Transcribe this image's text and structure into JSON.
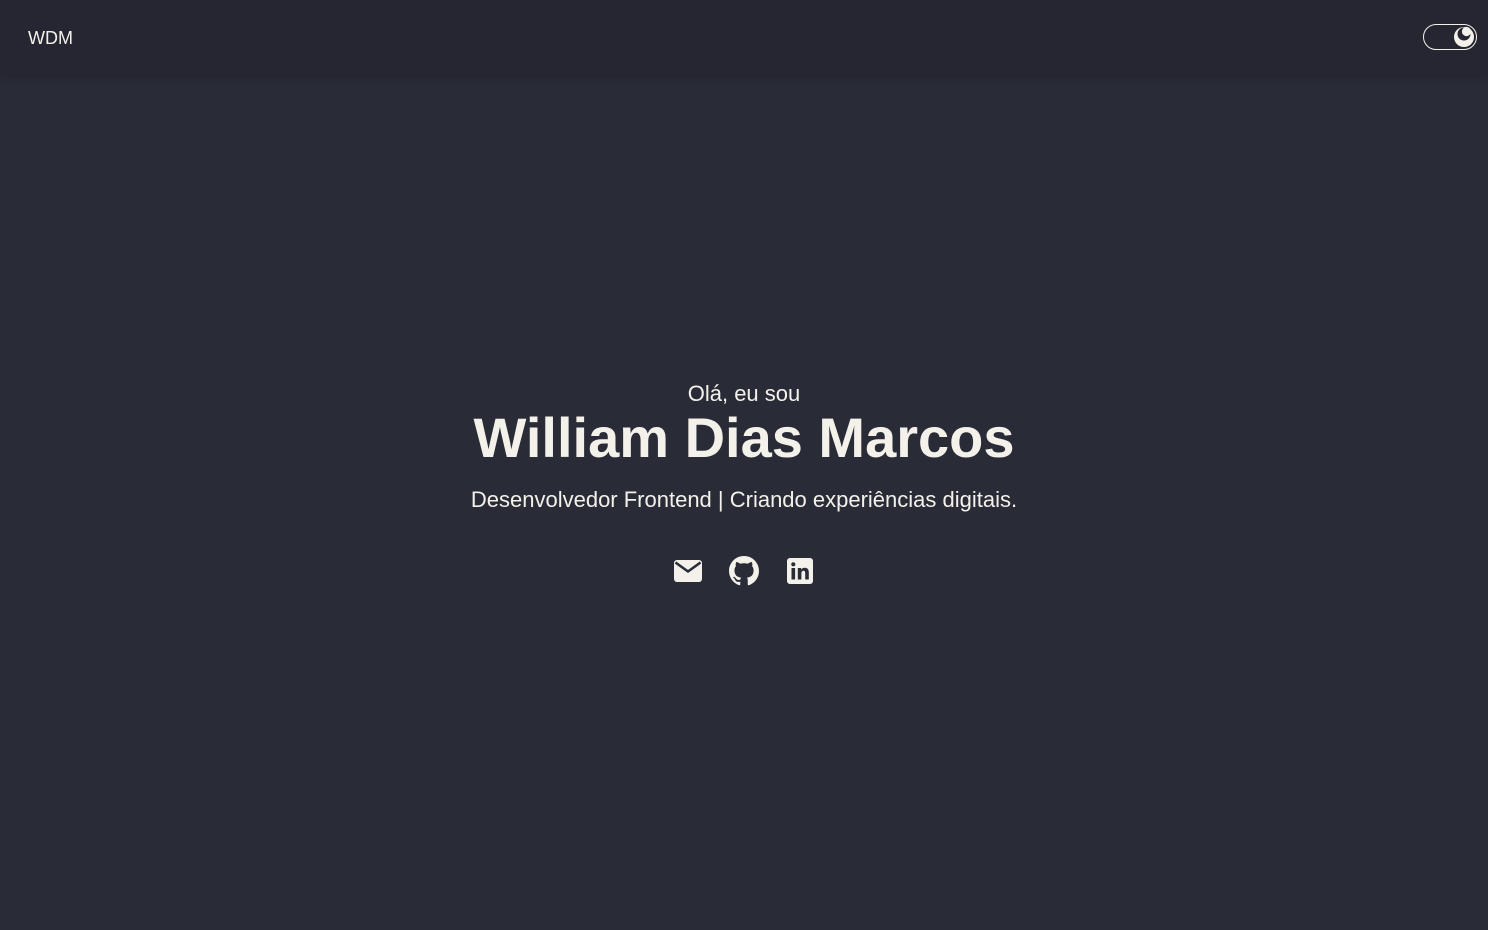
{
  "header": {
    "logo_text": "WDM",
    "theme_toggle": {
      "mode": "dark",
      "icon": "moon-icon"
    }
  },
  "hero": {
    "greeting": "Olá, eu sou",
    "name": "William Dias Marcos",
    "tagline": "Desenvolvedor Frontend | Criando experiências digitais."
  },
  "social": {
    "links": [
      {
        "icon": "envelope-icon"
      },
      {
        "icon": "github-icon"
      },
      {
        "icon": "linkedin-icon"
      }
    ]
  },
  "colors": {
    "background": "#292b37",
    "header_background": "#252631",
    "text": "#f3f1ea"
  }
}
